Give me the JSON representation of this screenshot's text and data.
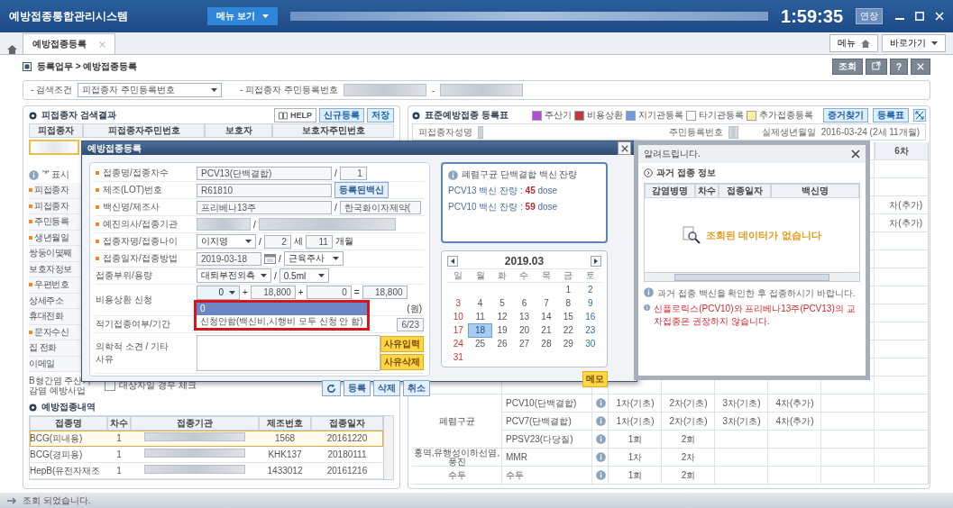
{
  "title_bar": {
    "app_name": "예방접종통합관리시스템",
    "menu_button": "메뉴 보기",
    "clock": "1:59:35",
    "extend_button": "연장"
  },
  "tab_bar": {
    "tabs": [
      {
        "label": "예방접종등록",
        "selected": true
      }
    ],
    "menu_button": "메뉴",
    "shortcut_button": "바로가기"
  },
  "breadcrumb": {
    "path": "등록업무 > 예방접종등록",
    "search_button": "조회",
    "help_button": "?"
  },
  "search": {
    "condition_label": "- 검색조건",
    "condition_value": "피접종자 주민등록번호",
    "id_label": "- 피접종자 주민등록번호",
    "separator": "-"
  },
  "left_panel": {
    "title": "피접종자 검색결과",
    "help_button": "HELP",
    "buttons": [
      "신규등록",
      "저장"
    ],
    "columns": [
      "피접종자",
      "피접종자주민번호",
      "보호자",
      "보호자주민번호"
    ],
    "note": "'*' 표시",
    "fields": [
      {
        "label": "피접종자",
        "required": true
      },
      {
        "label": "피접종자",
        "required": true
      },
      {
        "label": "주민등록",
        "required": true
      },
      {
        "label": "생년월일",
        "required": true
      },
      {
        "label": "쌍둥이몇째",
        "required": false
      },
      {
        "label": "보호자정보",
        "required": false
      },
      {
        "label": "우편번호",
        "required": true
      },
      {
        "label": "상세주소",
        "required": false
      },
      {
        "label": "휴대전화",
        "required": false
      },
      {
        "label": "문자수신",
        "required": true
      },
      {
        "label": "집 전화",
        "required": false
      },
      {
        "label": "이메일",
        "required": false
      }
    ],
    "hepb": {
      "label": "B형간염 주산기 감염 예방사업",
      "checkbox_label": "대상자일 경우 체크",
      "checked": false
    }
  },
  "history": {
    "title": "예방접종내역",
    "columns": [
      "접종명",
      "차수",
      "접종기관",
      "제조번호",
      "접종일자"
    ],
    "rows": [
      {
        "name": "BCG(피내용)",
        "dose": "1",
        "lot": "1568",
        "date": "20161220",
        "selected": true
      },
      {
        "name": "BCG(경피용)",
        "dose": "1",
        "lot": "KHK137",
        "date": "20180111",
        "selected": false
      },
      {
        "name": "HepB(유전자재조",
        "dose": "1",
        "lot": "1433012",
        "date": "20161216",
        "selected": false
      }
    ]
  },
  "right_panel": {
    "title": "표준예방접종 등록표",
    "legend": [
      {
        "label": "주산기",
        "color": "#b04fd0"
      },
      {
        "label": "비용상환",
        "color": "#c0393b"
      },
      {
        "label": "지기관등록",
        "color": "#6f9fd8"
      },
      {
        "label": "타기관등록",
        "color": "#ffffff"
      },
      {
        "label": "추가접종등록",
        "color": "#fbefa0"
      }
    ],
    "buttons": [
      "증거찾기",
      "등록표"
    ],
    "info": {
      "name_label": "피접종자성명",
      "id_label": "주민등록번호",
      "birth_label": "실제생년월일",
      "birth_value": "2016-03-24 (2세 11개월)"
    },
    "header_visible": "6차",
    "upper_rows": [
      {},
      {},
      {
        "fragment": "차(추가)"
      },
      {
        "fragment": "차(추가)"
      },
      {},
      {},
      {},
      {},
      {},
      {},
      {},
      {},
      {}
    ],
    "groups": [
      {
        "name": "폐렴구균",
        "vaccines": [
          {
            "name": "PCV10(단백결합)",
            "doses": [
              "1차(기초)",
              "2차(기초)",
              "3차(기초)",
              "4차(추가)"
            ]
          },
          {
            "name": "PCV7(단백결합)",
            "doses": [
              "1차(기초)",
              "2차(기초)",
              "3차(기초)",
              "4차(추가)"
            ]
          },
          {
            "name": "PPSV23(다당질)",
            "doses": [
              "1회",
              "2회"
            ]
          }
        ]
      },
      {
        "name": "홍역,유행성이하선염,풍진",
        "vaccines": [
          {
            "name": "MMR",
            "doses": [
              "1차",
              "2차"
            ]
          }
        ]
      },
      {
        "name": "수두",
        "vaccines": [
          {
            "name": "수두",
            "doses": [
              "1회",
              "2회"
            ]
          }
        ]
      }
    ]
  },
  "modal": {
    "title": "예방접종등록",
    "rows": [
      {
        "kind": "standard",
        "label": "접종명/접종차수",
        "required": true,
        "lines": [
          [
            {
              "kind": "field",
              "value": "PCV13(단백결합)"
            },
            {
              "kind": "text",
              "value": "/"
            },
            {
              "kind": "small-field",
              "value": "1"
            }
          ]
        ]
      },
      {
        "kind": "standard",
        "label": "제조(LOT)번호",
        "required": true,
        "lines": [
          [
            {
              "kind": "field",
              "value": "R61810"
            },
            {
              "kind": "button",
              "value": "등록된백신"
            }
          ]
        ]
      },
      {
        "kind": "standard",
        "label": "백신명/제조사",
        "required": true,
        "lines": [
          [
            {
              "kind": "field",
              "value": "프리베나13주"
            },
            {
              "kind": "text",
              "value": "/"
            },
            {
              "kind": "mid-field",
              "value": "한국화이자제약("
            }
          ]
        ]
      },
      {
        "kind": "standard",
        "label": "예진의사/접종기관",
        "required": true,
        "lines": [
          [
            {
              "kind": "blurred-select"
            },
            {
              "kind": "text",
              "value": "/"
            },
            {
              "kind": "blurred-field"
            }
          ]
        ]
      },
      {
        "kind": "standard",
        "label": "접종자명/접종나이",
        "required": true,
        "lines": [
          [
            {
              "kind": "select",
              "value": "이지영"
            },
            {
              "kind": "text",
              "value": "/"
            },
            {
              "kind": "small-field",
              "value": "2"
            },
            {
              "kind": "text",
              "value": "세"
            },
            {
              "kind": "small-field",
              "value": "11"
            },
            {
              "kind": "text",
              "value": "개월"
            }
          ]
        ]
      },
      {
        "kind": "standard",
        "label": "접종일자/접종방법",
        "required": true,
        "lines": [
          [
            {
              "kind": "date-field",
              "value": "2019-03-18"
            },
            {
              "kind": "calendar-icon"
            },
            {
              "kind": "text",
              "value": "/"
            },
            {
              "kind": "select",
              "value": "근육주사"
            }
          ]
        ]
      },
      {
        "kind": "standard",
        "label": "접종부위/용량",
        "required": false,
        "lines": [
          [
            {
              "kind": "select",
              "value": "대퇴부전외측"
            },
            {
              "kind": "text",
              "value": "/"
            },
            {
              "kind": "small-select",
              "value": "0.5ml"
            }
          ]
        ]
      },
      {
        "kind": "cost",
        "label": "비용상환 신청",
        "required": false,
        "lines": [
          [
            {
              "kind": "money-select",
              "value": "0"
            },
            {
              "kind": "text",
              "value": "+"
            },
            {
              "kind": "money-field",
              "value": "18,800"
            },
            {
              "kind": "text",
              "value": "+"
            },
            {
              "kind": "money-field",
              "value": "0"
            },
            {
              "kind": "text",
              "value": "="
            },
            {
              "kind": "money-field",
              "value": "18,800"
            }
          ],
          [
            {
              "kind": "text",
              "value": "(원)"
            }
          ]
        ]
      },
      {
        "kind": "period",
        "label": "적기접종여부/기간",
        "required": false,
        "lines": [
          [
            {
              "kind": "small-field",
              "value": "6/23"
            }
          ]
        ]
      },
      {
        "kind": "remark",
        "label": "의학적 소견 / 기타 사유",
        "required": false,
        "buttons": [
          "사유입력",
          "사유삭제"
        ]
      }
    ],
    "footer_buttons": [
      {
        "kind": "refresh"
      },
      {
        "kind": "label",
        "label": "등록"
      },
      {
        "kind": "label",
        "label": "삭제"
      },
      {
        "kind": "label",
        "label": "취소"
      }
    ],
    "dropdown": {
      "options": [
        {
          "label": "0",
          "selected": true
        },
        {
          "label": "신청안함(백신비,시행비 모두 신청 안 함)",
          "selected": false
        }
      ]
    },
    "stock": {
      "title": "폐렴구균 단백결합 백신 잔량",
      "lines": [
        "PCV13 백신 잔량 : **45** dose",
        "PCV10 백신 잔량 : **59** dose"
      ]
    },
    "calendar": {
      "month": "2019.03",
      "weekdays": [
        "일",
        "월",
        "화",
        "수",
        "목",
        "금",
        "토"
      ],
      "weeks": [
        [
          {
            "d": "1",
            "selected": false
          },
          {
            "d": "2",
            "selected": false
          }
        ],
        [
          {
            "d": "3",
            "selected": false
          },
          {
            "d": "4",
            "selected": false
          },
          {
            "d": "5",
            "selected": false
          },
          {
            "d": "6",
            "selected": false
          },
          {
            "d": "7",
            "selected": false
          },
          {
            "d": "8",
            "selected": false
          },
          {
            "d": "9",
            "selected": false
          }
        ],
        [
          {
            "d": "10",
            "selected": false
          },
          {
            "d": "11",
            "selected": false
          },
          {
            "d": "12",
            "selected": false
          },
          {
            "d": "13",
            "selected": false
          },
          {
            "d": "14",
            "selected": false
          },
          {
            "d": "15",
            "selected": false
          },
          {
            "d": "16",
            "selected": false
          }
        ],
        [
          {
            "d": "17",
            "selected": false
          },
          {
            "d": "18",
            "selected": true
          },
          {
            "d": "19",
            "selected": false
          },
          {
            "d": "20",
            "selected": false
          },
          {
            "d": "21",
            "selected": false
          },
          {
            "d": "22",
            "selected": false
          },
          {
            "d": "23",
            "selected": false
          }
        ],
        [
          {
            "d": "24",
            "selected": false
          },
          {
            "d": "25",
            "selected": false
          },
          {
            "d": "26",
            "selected": false
          },
          {
            "d": "27",
            "selected": false
          },
          {
            "d": "28",
            "selected": false
          },
          {
            "d": "29",
            "selected": false
          },
          {
            "d": "30",
            "selected": false
          }
        ],
        [
          {
            "d": "31",
            "selected": false
          }
        ]
      ]
    },
    "memo_button": "메모"
  },
  "alert": {
    "title": "알려드립니다.",
    "section": "과거 접종 정보",
    "columns": [
      "감염병명",
      "차수",
      "접종일자",
      "백신명"
    ],
    "empty_message": "조회된 데이터가 없습니다",
    "notes": [
      {
        "kind": "normal",
        "text": "과거 접종 백신을 확인한 후 접종하시기 바랍니다."
      },
      {
        "kind": "warning",
        "text": "신플로릭스(PCV10)와 프리베나13주(PCV13)의 교차접종은 권장하지 않습니다."
      }
    ]
  },
  "status_bar": {
    "message": "조회 되었습니다."
  }
}
